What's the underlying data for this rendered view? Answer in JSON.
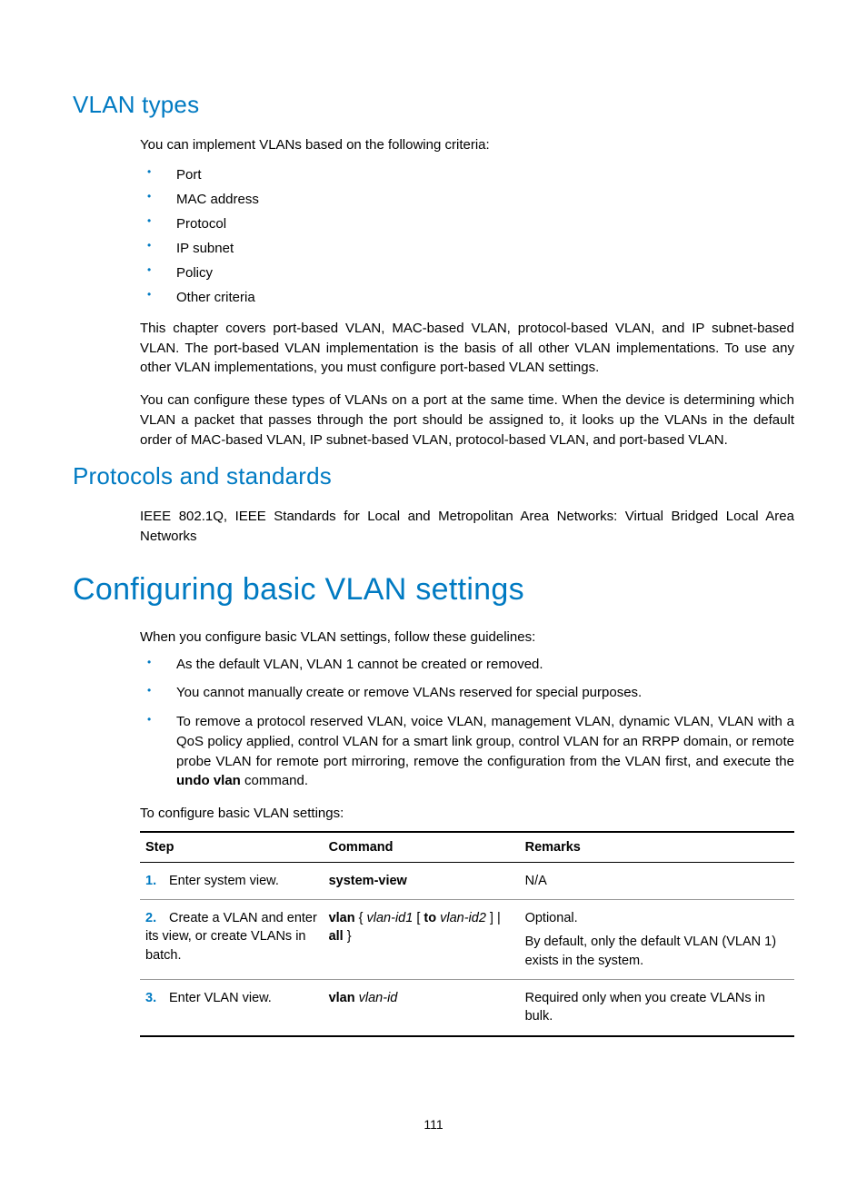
{
  "sections": {
    "vlan_types": {
      "title": "VLAN types",
      "intro": "You can implement VLANs based on the following criteria:",
      "criteria": [
        "Port",
        "MAC address",
        "Protocol",
        "IP subnet",
        "Policy",
        "Other criteria"
      ],
      "para1": "This chapter covers port-based VLAN, MAC-based VLAN, protocol-based VLAN, and IP subnet-based VLAN. The port-based VLAN implementation is the basis of all other VLAN implementations. To use any other VLAN implementations, you must configure port-based VLAN settings.",
      "para2": "You can configure these types of VLANs on a port at the same time. When the device is determining which VLAN a packet that passes through the port should be assigned to, it looks up the VLANs in the default order of MAC-based VLAN, IP subnet-based VLAN, protocol-based VLAN, and port-based VLAN."
    },
    "protocols": {
      "title": "Protocols and standards",
      "para": "IEEE 802.1Q, IEEE Standards for Local and Metropolitan Area Networks: Virtual Bridged Local Area Networks"
    },
    "configuring": {
      "title": "Configuring basic VLAN settings",
      "intro": "When you configure basic VLAN settings, follow these guidelines:",
      "guidelines": {
        "g0": "As the default VLAN, VLAN 1 cannot be created or removed.",
        "g1": "You cannot manually create or remove VLANs reserved for special purposes.",
        "g2_pre": "To remove a protocol reserved VLAN, voice VLAN, management VLAN, dynamic VLAN, VLAN with a QoS policy applied, control VLAN for a smart link group, control VLAN for an RRPP domain, or remote probe VLAN for remote port mirroring, remove the configuration from the VLAN first, and execute the ",
        "g2_cmd": "undo vlan",
        "g2_post": " command."
      },
      "lead": "To configure basic VLAN settings:"
    }
  },
  "table": {
    "headers": {
      "step": "Step",
      "command": "Command",
      "remarks": "Remarks"
    },
    "rows": [
      {
        "num": "1.",
        "step": "Enter system view.",
        "cmd_bold": "system-view",
        "remarks": "N/A"
      },
      {
        "num": "2.",
        "step": "Create a VLAN and enter its view, or create VLANs in batch.",
        "cmd_parts": {
          "b1": "vlan",
          "t1": " { ",
          "i1": "vlan-id1",
          "t2": " [ ",
          "b2": "to",
          "t3": " ",
          "i2": "vlan-id2",
          "t4": " ] | ",
          "b3": "all",
          "t5": " }"
        },
        "remarks_line1": "Optional.",
        "remarks_line2": "By default, only the default VLAN (VLAN 1) exists in the system."
      },
      {
        "num": "3.",
        "step": "Enter VLAN view.",
        "cmd_parts": {
          "b1": "vlan",
          "t1": " ",
          "i1": "vlan-id"
        },
        "remarks": "Required only when you create VLANs in bulk."
      }
    ]
  },
  "page_number": "111"
}
